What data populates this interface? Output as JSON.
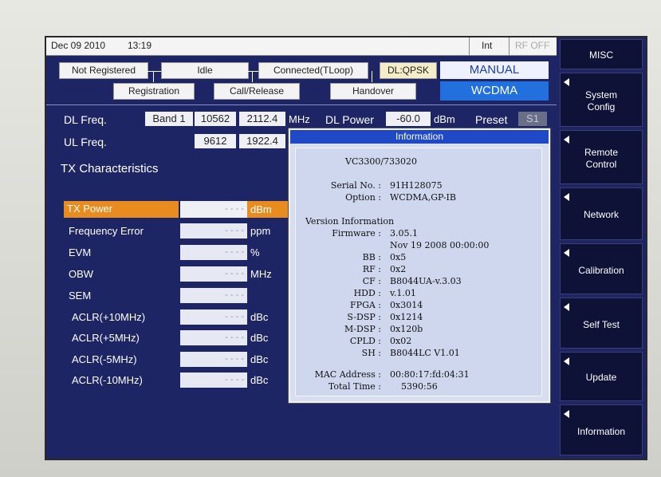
{
  "topbar": {
    "date": "Dec 09 2010",
    "time": "13:19",
    "int": "Int",
    "rf": "RF OFF"
  },
  "status": {
    "not_registered": "Not Registered",
    "idle": "Idle",
    "connected": "Connected(TLoop)",
    "dl_mod": "DL:QPSK",
    "registration": "Registration",
    "call_release": "Call/Release",
    "handover": "Handover",
    "manual": "MANUAL",
    "wcdma": "WCDMA"
  },
  "freq": {
    "dl_label": "DL Freq.",
    "band": "Band 1",
    "dl_chan": "10562",
    "dl_mhz": "2112.4",
    "mhz": "MHz",
    "dl_power_label": "DL Power",
    "dl_power": "-60.0",
    "dbm": "dBm",
    "preset": "Preset",
    "preset_val": "S1",
    "ul_label": "UL Freq.",
    "ul_chan": "9612",
    "ul_mhz": "1922.4"
  },
  "tx": {
    "title": "TX  Characteristics",
    "rows": [
      {
        "label": "TX Power",
        "value": "- - - -",
        "unit": "dBm"
      },
      {
        "label": "Frequency  Error",
        "value": "- - - -",
        "unit": "ppm"
      },
      {
        "label": "EVM",
        "value": "- - - -",
        "unit": "%"
      },
      {
        "label": "OBW",
        "value": "- - - -",
        "unit": "MHz"
      },
      {
        "label": "SEM",
        "value": "- - - -",
        "unit": ""
      },
      {
        "label": "ACLR(+10MHz)",
        "value": "- - - -",
        "unit": "dBc"
      },
      {
        "label": "ACLR(+5MHz)",
        "value": "- - - -",
        "unit": "dBc"
      },
      {
        "label": "ACLR(-5MHz)",
        "value": "- - - -",
        "unit": "dBc"
      },
      {
        "label": "ACLR(-10MHz)",
        "value": "- - - -",
        "unit": "dBc"
      }
    ]
  },
  "info": {
    "title": "Information",
    "model": "VC3300/733020",
    "serial_label": "Serial No. :",
    "serial": "91H128075",
    "option_label": "Option :",
    "option": "WCDMA,GP-IB",
    "version_title": "Version Information",
    "firmware_label": "Firmware :",
    "firmware": "3.05.1",
    "firmware_date": "Nov 19 2008 00:00:00",
    "versions": [
      {
        "k": "BB :",
        "v": "0x5"
      },
      {
        "k": "RF :",
        "v": "0x2"
      },
      {
        "k": "CF :",
        "v": "B8044UA-v.3.03"
      },
      {
        "k": "HDD :",
        "v": "v.1.01"
      },
      {
        "k": "FPGA :",
        "v": "0x3014"
      },
      {
        "k": "S-DSP :",
        "v": "0x1214"
      },
      {
        "k": "M-DSP :",
        "v": "0x120b"
      },
      {
        "k": "CPLD :",
        "v": "0x02"
      },
      {
        "k": "SH :",
        "v": "B8044LC V1.01"
      }
    ],
    "mac_label": "MAC Address :",
    "mac": "00:80:17:fd:04:31",
    "total_label": "Total Time :",
    "total": "5390:56"
  },
  "softkeys": {
    "misc": "MISC",
    "system_config": "System\nConfig",
    "remote_control": "Remote\nControl",
    "network": "Network",
    "calibration": "Calibration",
    "self_test": "Self Test",
    "update": "Update",
    "information": "Information"
  }
}
